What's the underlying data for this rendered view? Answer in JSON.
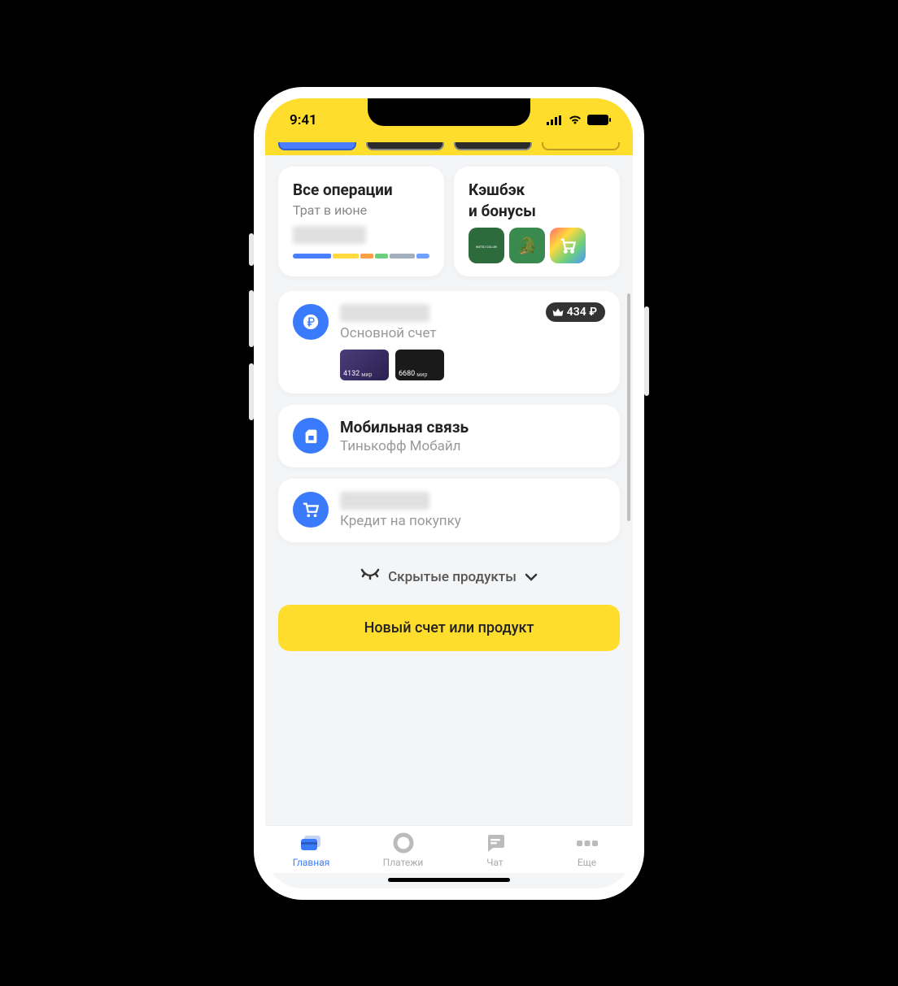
{
  "status": {
    "time": "9:41"
  },
  "tiles": {
    "operations": {
      "title": "Все операции",
      "subtitle": "Трат в июне"
    },
    "cashback": {
      "title_l1": "Кэшбэк",
      "title_l2": "и бонусы"
    }
  },
  "accounts": {
    "main": {
      "label": "Основной счет",
      "badge": "434 ₽",
      "cards": [
        {
          "last4": "4132",
          "ps": "мир"
        },
        {
          "last4": "6680",
          "ps": "мир"
        }
      ]
    },
    "mobile": {
      "title": "Мобильная связь",
      "subtitle": "Тинькофф Мобайл"
    },
    "credit": {
      "label": "Кредит на покупку"
    }
  },
  "hidden_products_label": "Скрытые продукты",
  "cta_label": "Новый счет или продукт",
  "tabs": {
    "home": "Главная",
    "payments": "Платежи",
    "chat": "Чат",
    "more": "Еще"
  }
}
